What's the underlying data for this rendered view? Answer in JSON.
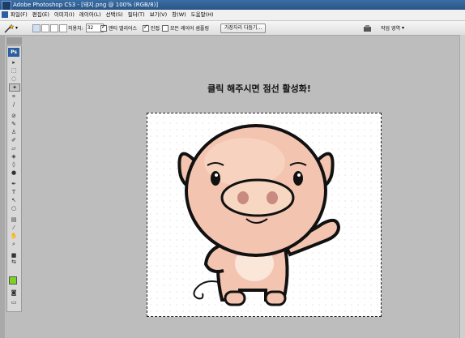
{
  "window": {
    "title": "Adobe Photoshop CS3 - [돼지.png @ 100% (RGB/8)]"
  },
  "menu": {
    "items": [
      "파일(F)",
      "편집(E)",
      "이미지(I)",
      "레이어(L)",
      "선택(S)",
      "필터(T)",
      "보기(V)",
      "창(W)",
      "도움말(H)"
    ]
  },
  "options": {
    "tolerance_label": "허용치:",
    "tolerance_value": "32",
    "antialias_label": "앤티 앨리어스",
    "contiguous_label": "인접",
    "sample_all_label": "모든 레이어 샘플링",
    "refine_edge_label": "가장자리 다듬기...",
    "workspace_label": "작업 영역"
  },
  "toolbox": {
    "badge": "Ps",
    "foreground_color": "#7ed321",
    "background_color": "#ffffff"
  },
  "canvas": {
    "instruction": "클릭 해주시면 점선 활성화!",
    "image_subject": "cartoon-pig-waving-icon"
  }
}
